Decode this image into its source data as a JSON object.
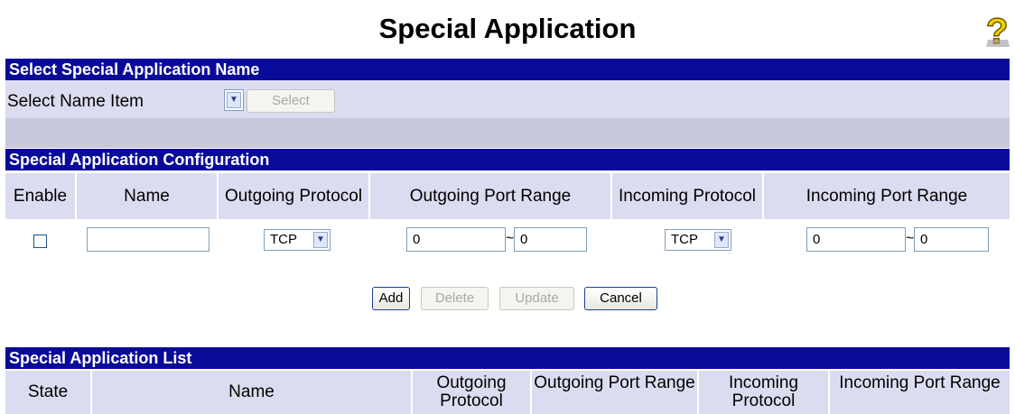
{
  "page": {
    "title": "Special Application"
  },
  "select_section": {
    "header": "Select Special Application Name",
    "label": "Select Name Item",
    "dropdown_value": "",
    "select_button": "Select"
  },
  "config_section": {
    "header": "Special Application Configuration",
    "columns": {
      "enable": "Enable",
      "name": "Name",
      "outgoing_protocol": "Outgoing Protocol",
      "outgoing_port_range": "Outgoing Port Range",
      "incoming_protocol": "Incoming Protocol",
      "incoming_port_range": "Incoming Port Range"
    },
    "row": {
      "enable_checked": false,
      "name": "",
      "outgoing_protocol": "TCP",
      "outgoing_port_start": "0",
      "outgoing_port_end": "0",
      "incoming_protocol": "TCP",
      "incoming_port_start": "0",
      "incoming_port_end": "0",
      "range_separator": "~"
    }
  },
  "actions": {
    "add": "Add",
    "delete": "Delete",
    "update": "Update",
    "cancel": "Cancel"
  },
  "list_section": {
    "header": "Special Application List",
    "columns": {
      "state": "State",
      "name": "Name",
      "outgoing_protocol": "Outgoing Protocol",
      "outgoing_port_range": "Outgoing Port Range",
      "incoming_protocol": "Incoming Protocol",
      "incoming_port_range": "Incoming Port Range"
    }
  },
  "icons": {
    "help": "help-question-icon",
    "dropdown": "chevron-down-icon"
  },
  "colors": {
    "header_bg": "#0a0a9a",
    "row_bg": "#dcdcf0"
  }
}
